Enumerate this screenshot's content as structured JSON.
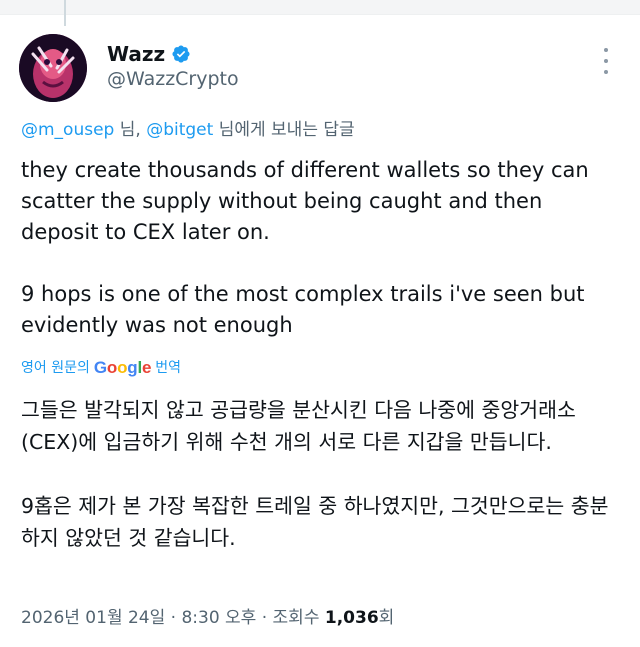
{
  "author": {
    "name": "Wazz",
    "handle": "@WazzCrypto"
  },
  "reply_context": {
    "mention_1": "@m_ousep",
    "sep_1": " 님, ",
    "mention_2": "@bitget",
    "suffix": " 님에게 보내는 답글"
  },
  "tweet": {
    "paragraph_1": "they create thousands of different wallets so they can scatter the supply without being caught and then deposit to CEX later on.",
    "paragraph_2": "9 hops is one of the most complex trails i've seen but evidently was not enough"
  },
  "translation": {
    "prefix": "영어 원문의",
    "provider": "Google",
    "suffix": "번역",
    "paragraph_1": "그들은 발각되지 않고 공급량을 분산시킨 다음 나중에 중앙거래소(CEX)에 입금하기 위해 수천 개의 서로 다른 지갑을 만듭니다.",
    "paragraph_2": "9홉은 제가 본 가장 복잡한 트레일 중 하나였지만, 그것만으로는 충분하지 않았던 것 같습니다."
  },
  "meta": {
    "datetime": "2026년 01월 24일 · 8:30 오후 · 조회수 ",
    "views": "1,036",
    "views_suffix": "회"
  },
  "icons": {
    "verified": "verified-badge-icon",
    "more": "more-options-icon"
  },
  "colors": {
    "accent": "#1d9bf0",
    "text": "#0f1419",
    "secondary": "#536471"
  }
}
